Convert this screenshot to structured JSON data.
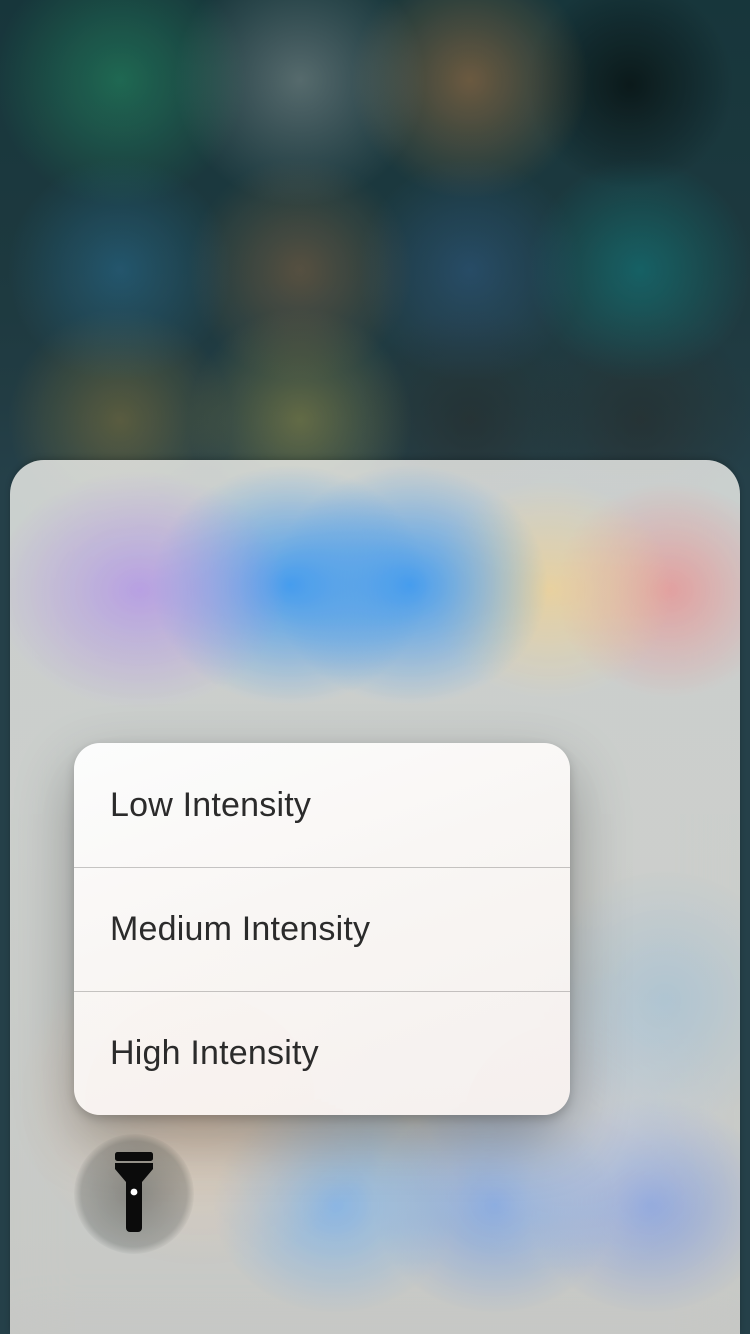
{
  "quick_actions": {
    "flashlight": {
      "icon": "flashlight-icon",
      "menu": {
        "items": [
          {
            "label": "Low Intensity"
          },
          {
            "label": "Medium Intensity"
          },
          {
            "label": "High Intensity"
          }
        ]
      }
    }
  }
}
